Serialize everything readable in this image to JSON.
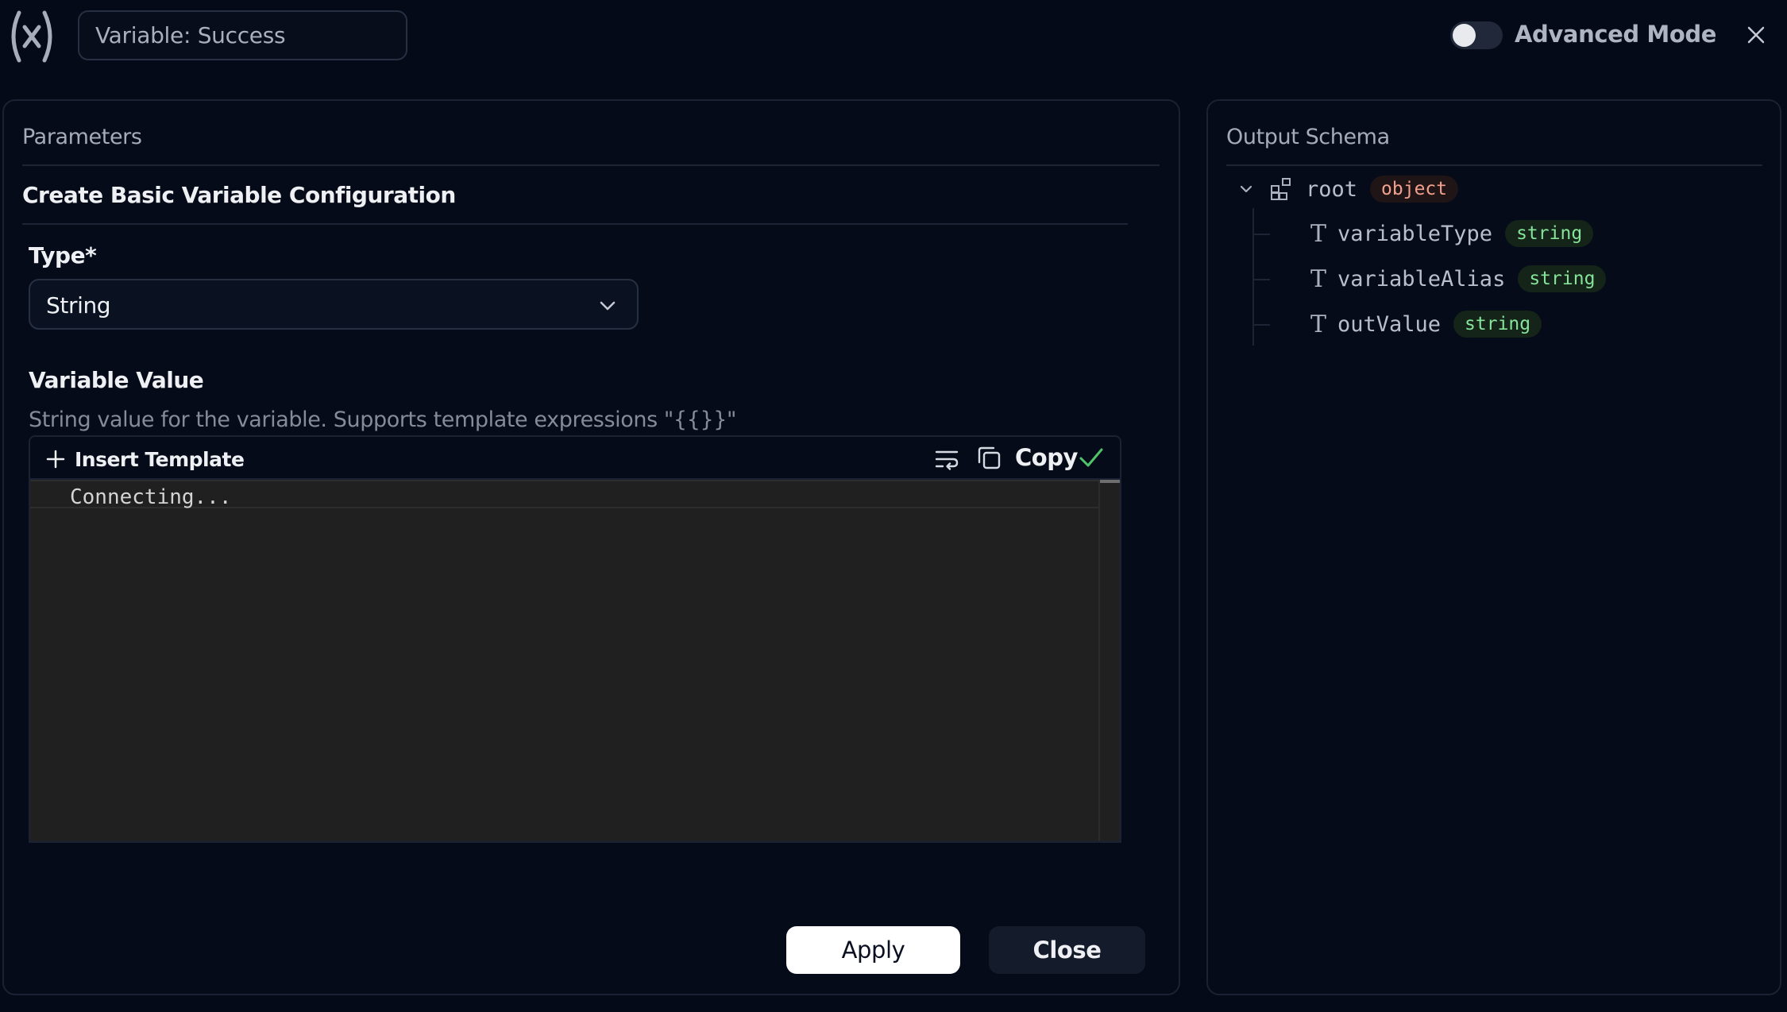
{
  "header": {
    "title_value": "Variable: Success",
    "advanced_mode_label": "Advanced Mode",
    "advanced_mode_on": false,
    "icons": {
      "logo": "variable-icon",
      "close": "close-icon"
    }
  },
  "parameters": {
    "heading": "Parameters",
    "section_title": "Create Basic Variable Configuration",
    "type_label": "Type*",
    "type_value": "String",
    "variable_value_label": "Variable Value",
    "variable_value_description": "String value for the variable. Supports template expressions \"{{}}\"",
    "editor": {
      "insert_template_label": "Insert Template",
      "copy_label": "Copy",
      "content": "Connecting..."
    },
    "buttons": {
      "apply": "Apply",
      "close": "Close"
    }
  },
  "output_schema": {
    "heading": "Output Schema",
    "root": {
      "name": "root",
      "type": "object"
    },
    "fields": [
      {
        "name": "variableType",
        "type": "string"
      },
      {
        "name": "variableAlias",
        "type": "string"
      },
      {
        "name": "outValue",
        "type": "string"
      }
    ]
  },
  "colors": {
    "background": "#040a17",
    "accent_check": "#4fc46a",
    "badge_object": "#f3a08e",
    "badge_string": "#86e39a"
  }
}
